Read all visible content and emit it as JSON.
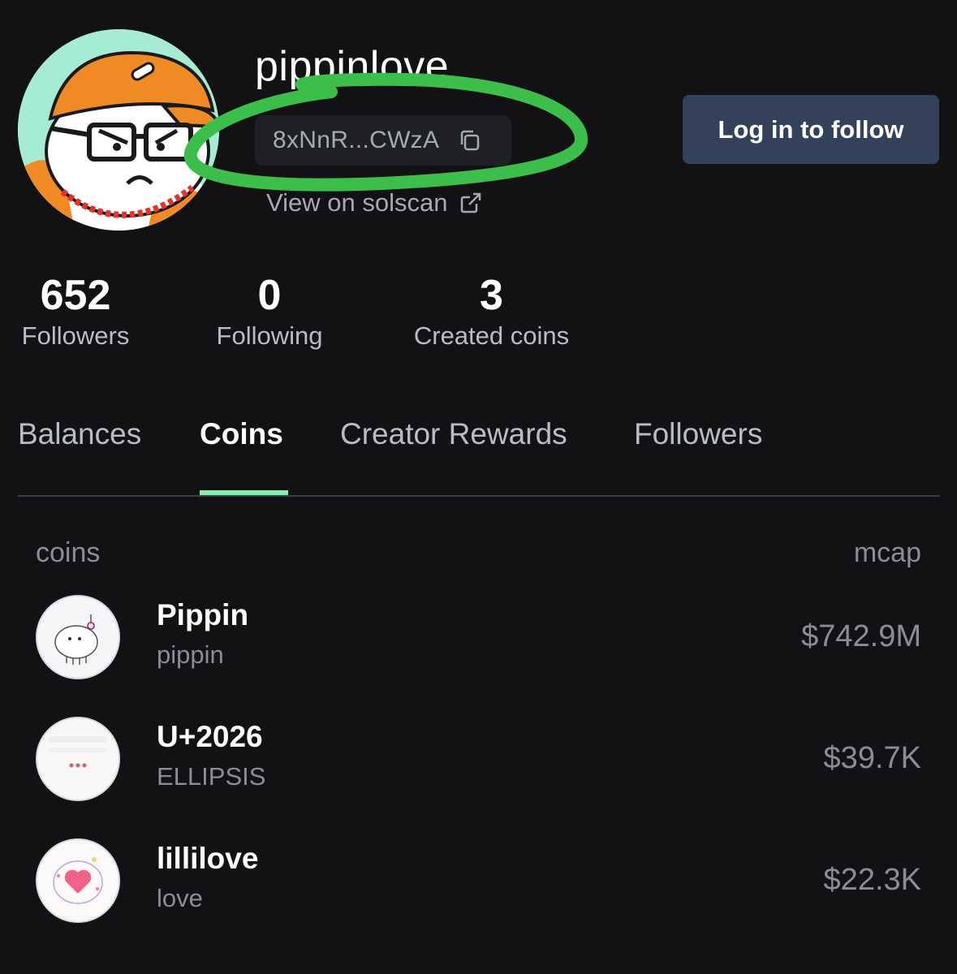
{
  "profile": {
    "username": "pippinlove",
    "address_short": "8xNnR...CWzA",
    "solscan_label": "View on solscan",
    "follow_button_label": "Log in to follow"
  },
  "stats": {
    "followers": {
      "value": "652",
      "label": "Followers"
    },
    "following": {
      "value": "0",
      "label": "Following"
    },
    "created": {
      "value": "3",
      "label": "Created coins"
    }
  },
  "tabs": [
    {
      "label": "Balances",
      "active": false
    },
    {
      "label": "Coins",
      "active": true
    },
    {
      "label": "Creator Rewards",
      "active": false
    },
    {
      "label": "Followers",
      "active": false
    }
  ],
  "table": {
    "col_coins": "coins",
    "col_mcap": "mcap",
    "rows": [
      {
        "name": "Pippin",
        "ticker": "pippin",
        "mcap": "$742.9M"
      },
      {
        "name": "U+2026",
        "ticker": "ELLIPSIS",
        "mcap": "$39.7K"
      },
      {
        "name": "lillilove",
        "ticker": "love",
        "mcap": "$22.3K"
      }
    ]
  },
  "colors": {
    "background": "#121215",
    "follow_button": "#33425a",
    "tab_indicator": "#86efac",
    "annotation_marker": "#3bbf4a"
  },
  "icons": {
    "copy": "copy-icon",
    "external_link": "external-link-icon"
  }
}
